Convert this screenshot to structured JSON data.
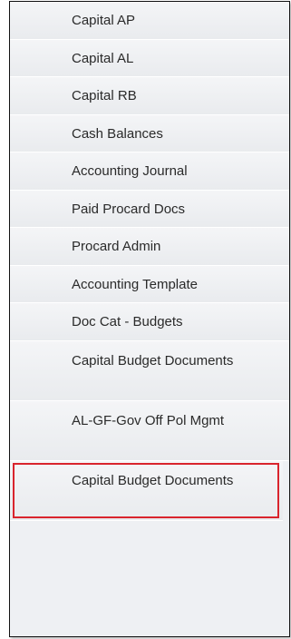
{
  "nav": {
    "items": [
      {
        "label": "Capital AP"
      },
      {
        "label": "Capital AL"
      },
      {
        "label": "Capital RB"
      },
      {
        "label": "Cash Balances"
      },
      {
        "label": "Accounting Journal"
      },
      {
        "label": "Paid Procard Docs"
      },
      {
        "label": "Procard Admin"
      },
      {
        "label": "Accounting Template"
      },
      {
        "label": "Doc Cat - Budgets"
      },
      {
        "label": "Capital Budget Documents"
      },
      {
        "label": "AL-GF-Gov Off Pol Mgmt"
      },
      {
        "label": "Capital Budget Documents"
      }
    ],
    "highlight_color": "#d9242d"
  }
}
